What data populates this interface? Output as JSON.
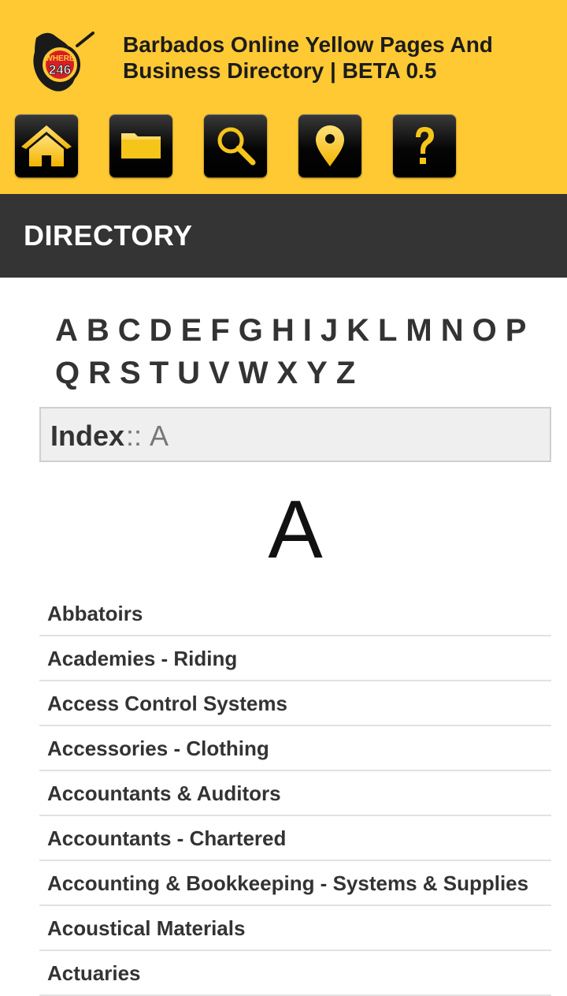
{
  "header": {
    "site_title": "Barbados Online Yellow Pages And Business Directory | BETA 0.5",
    "logo_text_top": "WHERE",
    "logo_text_bottom": "246",
    "background_color": "#ffc934"
  },
  "nav": {
    "buttons": [
      {
        "icon": "home-icon"
      },
      {
        "icon": "folder-icon"
      },
      {
        "icon": "search-icon"
      },
      {
        "icon": "location-pin-icon"
      },
      {
        "icon": "help-icon"
      }
    ]
  },
  "section": {
    "title": "DIRECTORY"
  },
  "alphabet": [
    "A",
    "B",
    "C",
    "D",
    "E",
    "F",
    "G",
    "H",
    "I",
    "J",
    "K",
    "L",
    "M",
    "N",
    "O",
    "P",
    "Q",
    "R",
    "S",
    "T",
    "U",
    "V",
    "W",
    "X",
    "Y",
    "Z"
  ],
  "index": {
    "label": "Index",
    "separator": "::",
    "current": "A"
  },
  "current_letter": "A",
  "categories": [
    "Abbatoirs",
    "Academies - Riding",
    "Access Control Systems",
    "Accessories - Clothing",
    "Accountants & Auditors",
    "Accountants - Chartered",
    "Accounting & Bookkeeping - Systems & Supplies",
    "Acoustical Materials",
    "Actuaries"
  ]
}
